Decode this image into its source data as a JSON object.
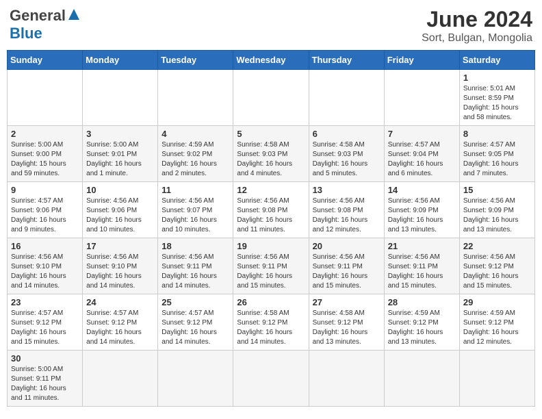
{
  "header": {
    "logo_general": "General",
    "logo_blue": "Blue",
    "title": "June 2024",
    "subtitle": "Sort, Bulgan, Mongolia"
  },
  "weekdays": [
    "Sunday",
    "Monday",
    "Tuesday",
    "Wednesday",
    "Thursday",
    "Friday",
    "Saturday"
  ],
  "days": {
    "d1": {
      "num": "1",
      "info": "Sunrise: 5:01 AM\nSunset: 8:59 PM\nDaylight: 15 hours\nand 58 minutes."
    },
    "d2": {
      "num": "2",
      "info": "Sunrise: 5:00 AM\nSunset: 9:00 PM\nDaylight: 15 hours\nand 59 minutes."
    },
    "d3": {
      "num": "3",
      "info": "Sunrise: 5:00 AM\nSunset: 9:01 PM\nDaylight: 16 hours\nand 1 minute."
    },
    "d4": {
      "num": "4",
      "info": "Sunrise: 4:59 AM\nSunset: 9:02 PM\nDaylight: 16 hours\nand 2 minutes."
    },
    "d5": {
      "num": "5",
      "info": "Sunrise: 4:58 AM\nSunset: 9:03 PM\nDaylight: 16 hours\nand 4 minutes."
    },
    "d6": {
      "num": "6",
      "info": "Sunrise: 4:58 AM\nSunset: 9:03 PM\nDaylight: 16 hours\nand 5 minutes."
    },
    "d7": {
      "num": "7",
      "info": "Sunrise: 4:57 AM\nSunset: 9:04 PM\nDaylight: 16 hours\nand 6 minutes."
    },
    "d8": {
      "num": "8",
      "info": "Sunrise: 4:57 AM\nSunset: 9:05 PM\nDaylight: 16 hours\nand 7 minutes."
    },
    "d9": {
      "num": "9",
      "info": "Sunrise: 4:57 AM\nSunset: 9:06 PM\nDaylight: 16 hours\nand 9 minutes."
    },
    "d10": {
      "num": "10",
      "info": "Sunrise: 4:56 AM\nSunset: 9:06 PM\nDaylight: 16 hours\nand 10 minutes."
    },
    "d11": {
      "num": "11",
      "info": "Sunrise: 4:56 AM\nSunset: 9:07 PM\nDaylight: 16 hours\nand 10 minutes."
    },
    "d12": {
      "num": "12",
      "info": "Sunrise: 4:56 AM\nSunset: 9:08 PM\nDaylight: 16 hours\nand 11 minutes."
    },
    "d13": {
      "num": "13",
      "info": "Sunrise: 4:56 AM\nSunset: 9:08 PM\nDaylight: 16 hours\nand 12 minutes."
    },
    "d14": {
      "num": "14",
      "info": "Sunrise: 4:56 AM\nSunset: 9:09 PM\nDaylight: 16 hours\nand 13 minutes."
    },
    "d15": {
      "num": "15",
      "info": "Sunrise: 4:56 AM\nSunset: 9:09 PM\nDaylight: 16 hours\nand 13 minutes."
    },
    "d16": {
      "num": "16",
      "info": "Sunrise: 4:56 AM\nSunset: 9:10 PM\nDaylight: 16 hours\nand 14 minutes."
    },
    "d17": {
      "num": "17",
      "info": "Sunrise: 4:56 AM\nSunset: 9:10 PM\nDaylight: 16 hours\nand 14 minutes."
    },
    "d18": {
      "num": "18",
      "info": "Sunrise: 4:56 AM\nSunset: 9:11 PM\nDaylight: 16 hours\nand 14 minutes."
    },
    "d19": {
      "num": "19",
      "info": "Sunrise: 4:56 AM\nSunset: 9:11 PM\nDaylight: 16 hours\nand 15 minutes."
    },
    "d20": {
      "num": "20",
      "info": "Sunrise: 4:56 AM\nSunset: 9:11 PM\nDaylight: 16 hours\nand 15 minutes."
    },
    "d21": {
      "num": "21",
      "info": "Sunrise: 4:56 AM\nSunset: 9:11 PM\nDaylight: 16 hours\nand 15 minutes."
    },
    "d22": {
      "num": "22",
      "info": "Sunrise: 4:56 AM\nSunset: 9:12 PM\nDaylight: 16 hours\nand 15 minutes."
    },
    "d23": {
      "num": "23",
      "info": "Sunrise: 4:57 AM\nSunset: 9:12 PM\nDaylight: 16 hours\nand 15 minutes."
    },
    "d24": {
      "num": "24",
      "info": "Sunrise: 4:57 AM\nSunset: 9:12 PM\nDaylight: 16 hours\nand 14 minutes."
    },
    "d25": {
      "num": "25",
      "info": "Sunrise: 4:57 AM\nSunset: 9:12 PM\nDaylight: 16 hours\nand 14 minutes."
    },
    "d26": {
      "num": "26",
      "info": "Sunrise: 4:58 AM\nSunset: 9:12 PM\nDaylight: 16 hours\nand 14 minutes."
    },
    "d27": {
      "num": "27",
      "info": "Sunrise: 4:58 AM\nSunset: 9:12 PM\nDaylight: 16 hours\nand 13 minutes."
    },
    "d28": {
      "num": "28",
      "info": "Sunrise: 4:59 AM\nSunset: 9:12 PM\nDaylight: 16 hours\nand 13 minutes."
    },
    "d29": {
      "num": "29",
      "info": "Sunrise: 4:59 AM\nSunset: 9:12 PM\nDaylight: 16 hours\nand 12 minutes."
    },
    "d30": {
      "num": "30",
      "info": "Sunrise: 5:00 AM\nSunset: 9:11 PM\nDaylight: 16 hours\nand 11 minutes."
    }
  }
}
